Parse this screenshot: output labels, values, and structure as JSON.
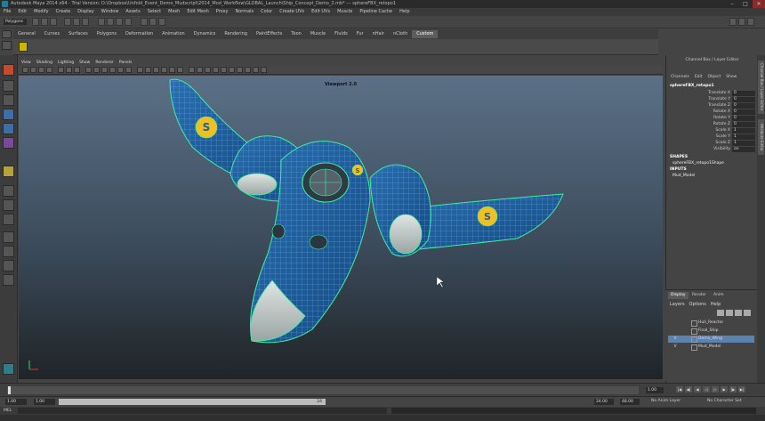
{
  "window": {
    "title": "Autodesk Maya 2014 x64 - Trial Version: D:\\Dropbox\\Unfold_Event_Demo_Mudscript\\2014_Mod_Workflow\\GLOBAL_Launch\\Ship_Concept_Demo_2.mb*   ---   sphereFBX_retopo1",
    "buttons": [
      "–",
      "□",
      "✕"
    ]
  },
  "menu": [
    "File",
    "Edit",
    "Modify",
    "Create",
    "Display",
    "Window",
    "Assets",
    "Select",
    "Mesh",
    "Edit Mesh",
    "Proxy",
    "Normals",
    "Color",
    "Create UVs",
    "Edit UVs",
    "Muscle",
    "Pipeline Cache",
    "Help"
  ],
  "status": {
    "mode": "Polygons"
  },
  "shelf": {
    "tabs": [
      "General",
      "Curves",
      "Surfaces",
      "Polygons",
      "Deformation",
      "Animation",
      "Dynamics",
      "Rendering",
      "PaintEffects",
      "Toon",
      "Muscle",
      "Fluids",
      "Fur",
      "nHair",
      "nCloth",
      "Custom"
    ],
    "active": "Custom"
  },
  "panel": {
    "menus": [
      "View",
      "Shading",
      "Lighting",
      "Show",
      "Renderer",
      "Panels"
    ],
    "label": "Viewport 2.0"
  },
  "channel_box": {
    "title": "Channel Box / Layer Editor",
    "menus": [
      "Channels",
      "Edit",
      "Object",
      "Show"
    ],
    "object": "sphereFBX_retopo1",
    "attributes": [
      {
        "name": "Translate X",
        "value": "0"
      },
      {
        "name": "Translate Y",
        "value": "0"
      },
      {
        "name": "Translate Z",
        "value": "0"
      },
      {
        "name": "Rotate X",
        "value": "0"
      },
      {
        "name": "Rotate Y",
        "value": "0"
      },
      {
        "name": "Rotate Z",
        "value": "0"
      },
      {
        "name": "Scale X",
        "value": "1"
      },
      {
        "name": "Scale Y",
        "value": "1"
      },
      {
        "name": "Scale Z",
        "value": "1"
      },
      {
        "name": "Visibility",
        "value": "on"
      }
    ],
    "shapes_label": "SHAPES",
    "shape_node": "sphereFBX_retopo1Shape",
    "inputs_label": "INPUTS",
    "input_node": "Mud_Model"
  },
  "side_tabs": [
    "Channel Box / Layer Editor",
    "Attribute Editor"
  ],
  "layer_editor": {
    "tabs": [
      "Display",
      "Render",
      "Anim"
    ],
    "active_tab": "Display",
    "menus": [
      "Layers",
      "Options",
      "Help"
    ],
    "layers": [
      {
        "name": "Hull_Reactor",
        "flag": "",
        "selected": false
      },
      {
        "name": "Final_Ship",
        "flag": "",
        "selected": false
      },
      {
        "name": "Demo_Wing",
        "flag": "V",
        "selected": true
      },
      {
        "name": "Mud_Model",
        "flag": "V",
        "selected": false
      }
    ]
  },
  "timeline": {
    "current_frame": "1.00",
    "start": "1.00",
    "inner_start": "1.00",
    "range_mark": "24",
    "end": "24.00",
    "end_max": "48.00",
    "anim_layer": "No Anim Layer",
    "character": "No Character Set"
  },
  "command_line": {
    "label": "MEL"
  },
  "colors": {
    "wire": "#3cf0a0",
    "hull": "#1e5f9e",
    "emblem": "#f0c020",
    "viewport_top": "#5b7087",
    "viewport_bottom": "#1f2427"
  }
}
